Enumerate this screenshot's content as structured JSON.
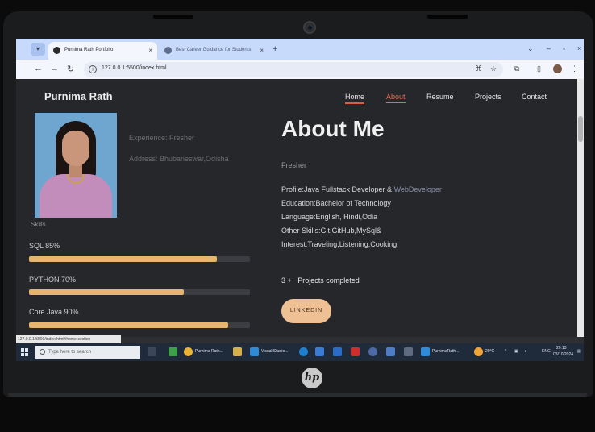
{
  "browser": {
    "tabs": [
      {
        "label": "Purnima Rath Portfolio",
        "active": true
      },
      {
        "label": "Best Career Guidance for Students",
        "active": false
      }
    ],
    "url": "127.0.0.1:5500/index.html",
    "status_url": "127.0.0.1:5500/index.html#home-section"
  },
  "site": {
    "brand": "Purnima Rath",
    "nav": [
      "Home",
      "About",
      "Resume",
      "Projects",
      "Contact"
    ]
  },
  "profile": {
    "experience": "Experience: Fresher",
    "address": "Address: Bhubaneswar,Odisha",
    "skills_heading": "Skills"
  },
  "skills": [
    {
      "label": "SQL 85%",
      "level": 0.85
    },
    {
      "label": "PYTHON 70%",
      "level": 0.7
    },
    {
      "label": "Core Java 90%",
      "level": 0.9
    }
  ],
  "about": {
    "title": "About Me",
    "subtitle": "Fresher",
    "profile_prefix": "Profile:Java Fullstack Developer & ",
    "profile_highlight": "WebDeveloper",
    "education": "Education:Bachelor of Technology",
    "language": "Language:English, Hindi,Odia",
    "other_skills": "Other Skills:Git,GitHub,MySql&",
    "interest": "Interest:Traveling,Listening,Cooking",
    "projects_count": "3 +",
    "projects_label": "Projects completed",
    "linkedin_button": "LINKEDIN"
  },
  "taskbar": {
    "search_placeholder": "Type here to search",
    "apps": [
      "Purnima Rath...",
      "Visual Studio...",
      "PurnimaRath..."
    ],
    "weather": "29°C",
    "language": "ENG",
    "time": "20:13",
    "date": "03/10/2024"
  },
  "colors": {
    "accent": "#e06b52",
    "skill_bar": "#e6b570",
    "button": "#efc093",
    "page_bg": "#26272b"
  }
}
